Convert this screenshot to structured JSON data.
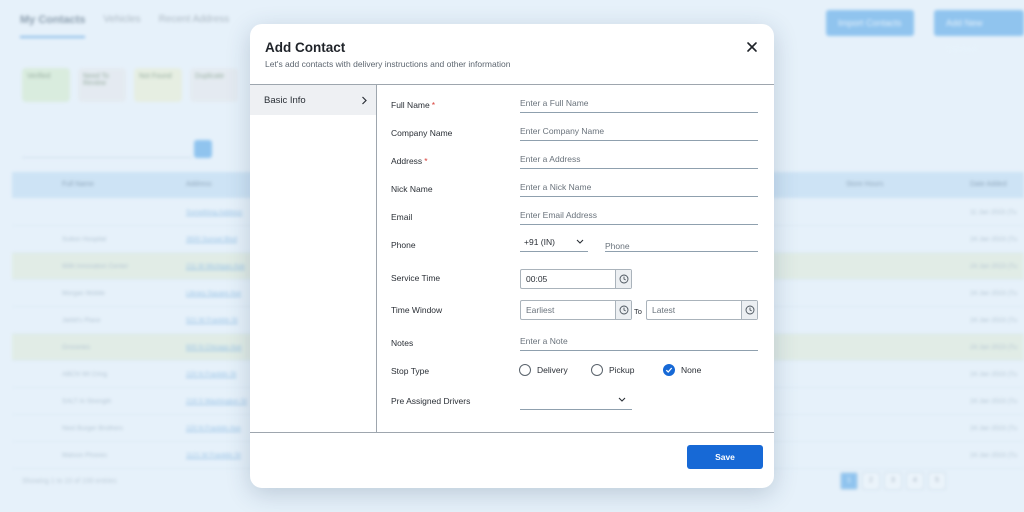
{
  "background": {
    "tabs": [
      "My Contacts",
      "Vehicles",
      "Recent Address"
    ],
    "buttons": [
      "Import Contacts",
      "Add New Contact"
    ],
    "cards": [
      "Verified",
      "Need To Review",
      "Not Found",
      "Duplicate"
    ],
    "columns": [
      "Full Name",
      "Address",
      "Store Hours",
      "Date Added"
    ],
    "rows": [
      {
        "name": "",
        "address": "Something Address",
        "date": "11 Jan 2023 (Tu"
      },
      {
        "name": "Sutton Hospital",
        "address": "3500 Sunset Blvd",
        "date": "24 Jan 2023 (Tu"
      },
      {
        "name": "With Innovation Center",
        "address": "211 W Michigan Ave",
        "date": "24 Jan 2023 (Tu"
      },
      {
        "name": "Morgan Mobile",
        "address": "Library Square Ave",
        "date": "24 Jan 2023 (Tu"
      },
      {
        "name": "Jarbit's Place",
        "address": "521 W Franklin St",
        "date": "24 Jan 2023 (Tu"
      },
      {
        "name": "Groceries",
        "address": "600 N Chicago Ave",
        "date": "24 Jan 2023 (Tu"
      },
      {
        "name": "ABCN Wt Cring",
        "address": "220 N Franklin St",
        "date": "24 Jan 2023 (Tu"
      },
      {
        "name": "SALT Ai Strength",
        "address": "219 S Washington St",
        "date": "24 Jan 2023 (Tu"
      },
      {
        "name": "Next Burger Brothers",
        "address": "220 N Franklin Ave",
        "date": "24 Jan 2023 (Tu"
      },
      {
        "name": "Matson Phones",
        "address": "1121 W Franklin St",
        "date": "24 Jan 2023 (Tu"
      }
    ],
    "footer": "Showing 1 to 10 of 100 entries",
    "pages": [
      "1",
      "2",
      "3",
      "4",
      "5"
    ]
  },
  "modal": {
    "title": "Add Contact",
    "subtitle": "Let's add contacts with delivery instructions and other information",
    "sidebar": {
      "item": "Basic Info"
    },
    "fields": {
      "full_name": {
        "label": "Full Name",
        "placeholder": "Enter a Full Name"
      },
      "company_name": {
        "label": "Company Name",
        "placeholder": "Enter Company Name"
      },
      "address": {
        "label": "Address",
        "placeholder": "Enter a Address"
      },
      "nick_name": {
        "label": "Nick Name",
        "placeholder": "Enter a Nick Name"
      },
      "email": {
        "label": "Email",
        "placeholder": "Enter Email Address"
      },
      "phone": {
        "label": "Phone",
        "country_code": "+91 (IN)",
        "placeholder": "Phone"
      },
      "service_time": {
        "label": "Service Time",
        "value": "00:05"
      },
      "time_window": {
        "label": "Time Window",
        "earliest_placeholder": "Earliest",
        "to": "To",
        "latest_placeholder": "Latest"
      },
      "notes": {
        "label": "Notes",
        "placeholder": "Enter a Note"
      },
      "stop_type": {
        "label": "Stop Type",
        "options": [
          "Delivery",
          "Pickup",
          "None"
        ],
        "selected": "None"
      },
      "pre_assigned_drivers": {
        "label": "Pre Assigned Drivers",
        "value": ""
      }
    },
    "required_marker": "*",
    "save_label": "Save"
  },
  "colors": {
    "primary": "#1769d6",
    "required": "#d9403a",
    "sidebar_active": "#eef0f3"
  }
}
